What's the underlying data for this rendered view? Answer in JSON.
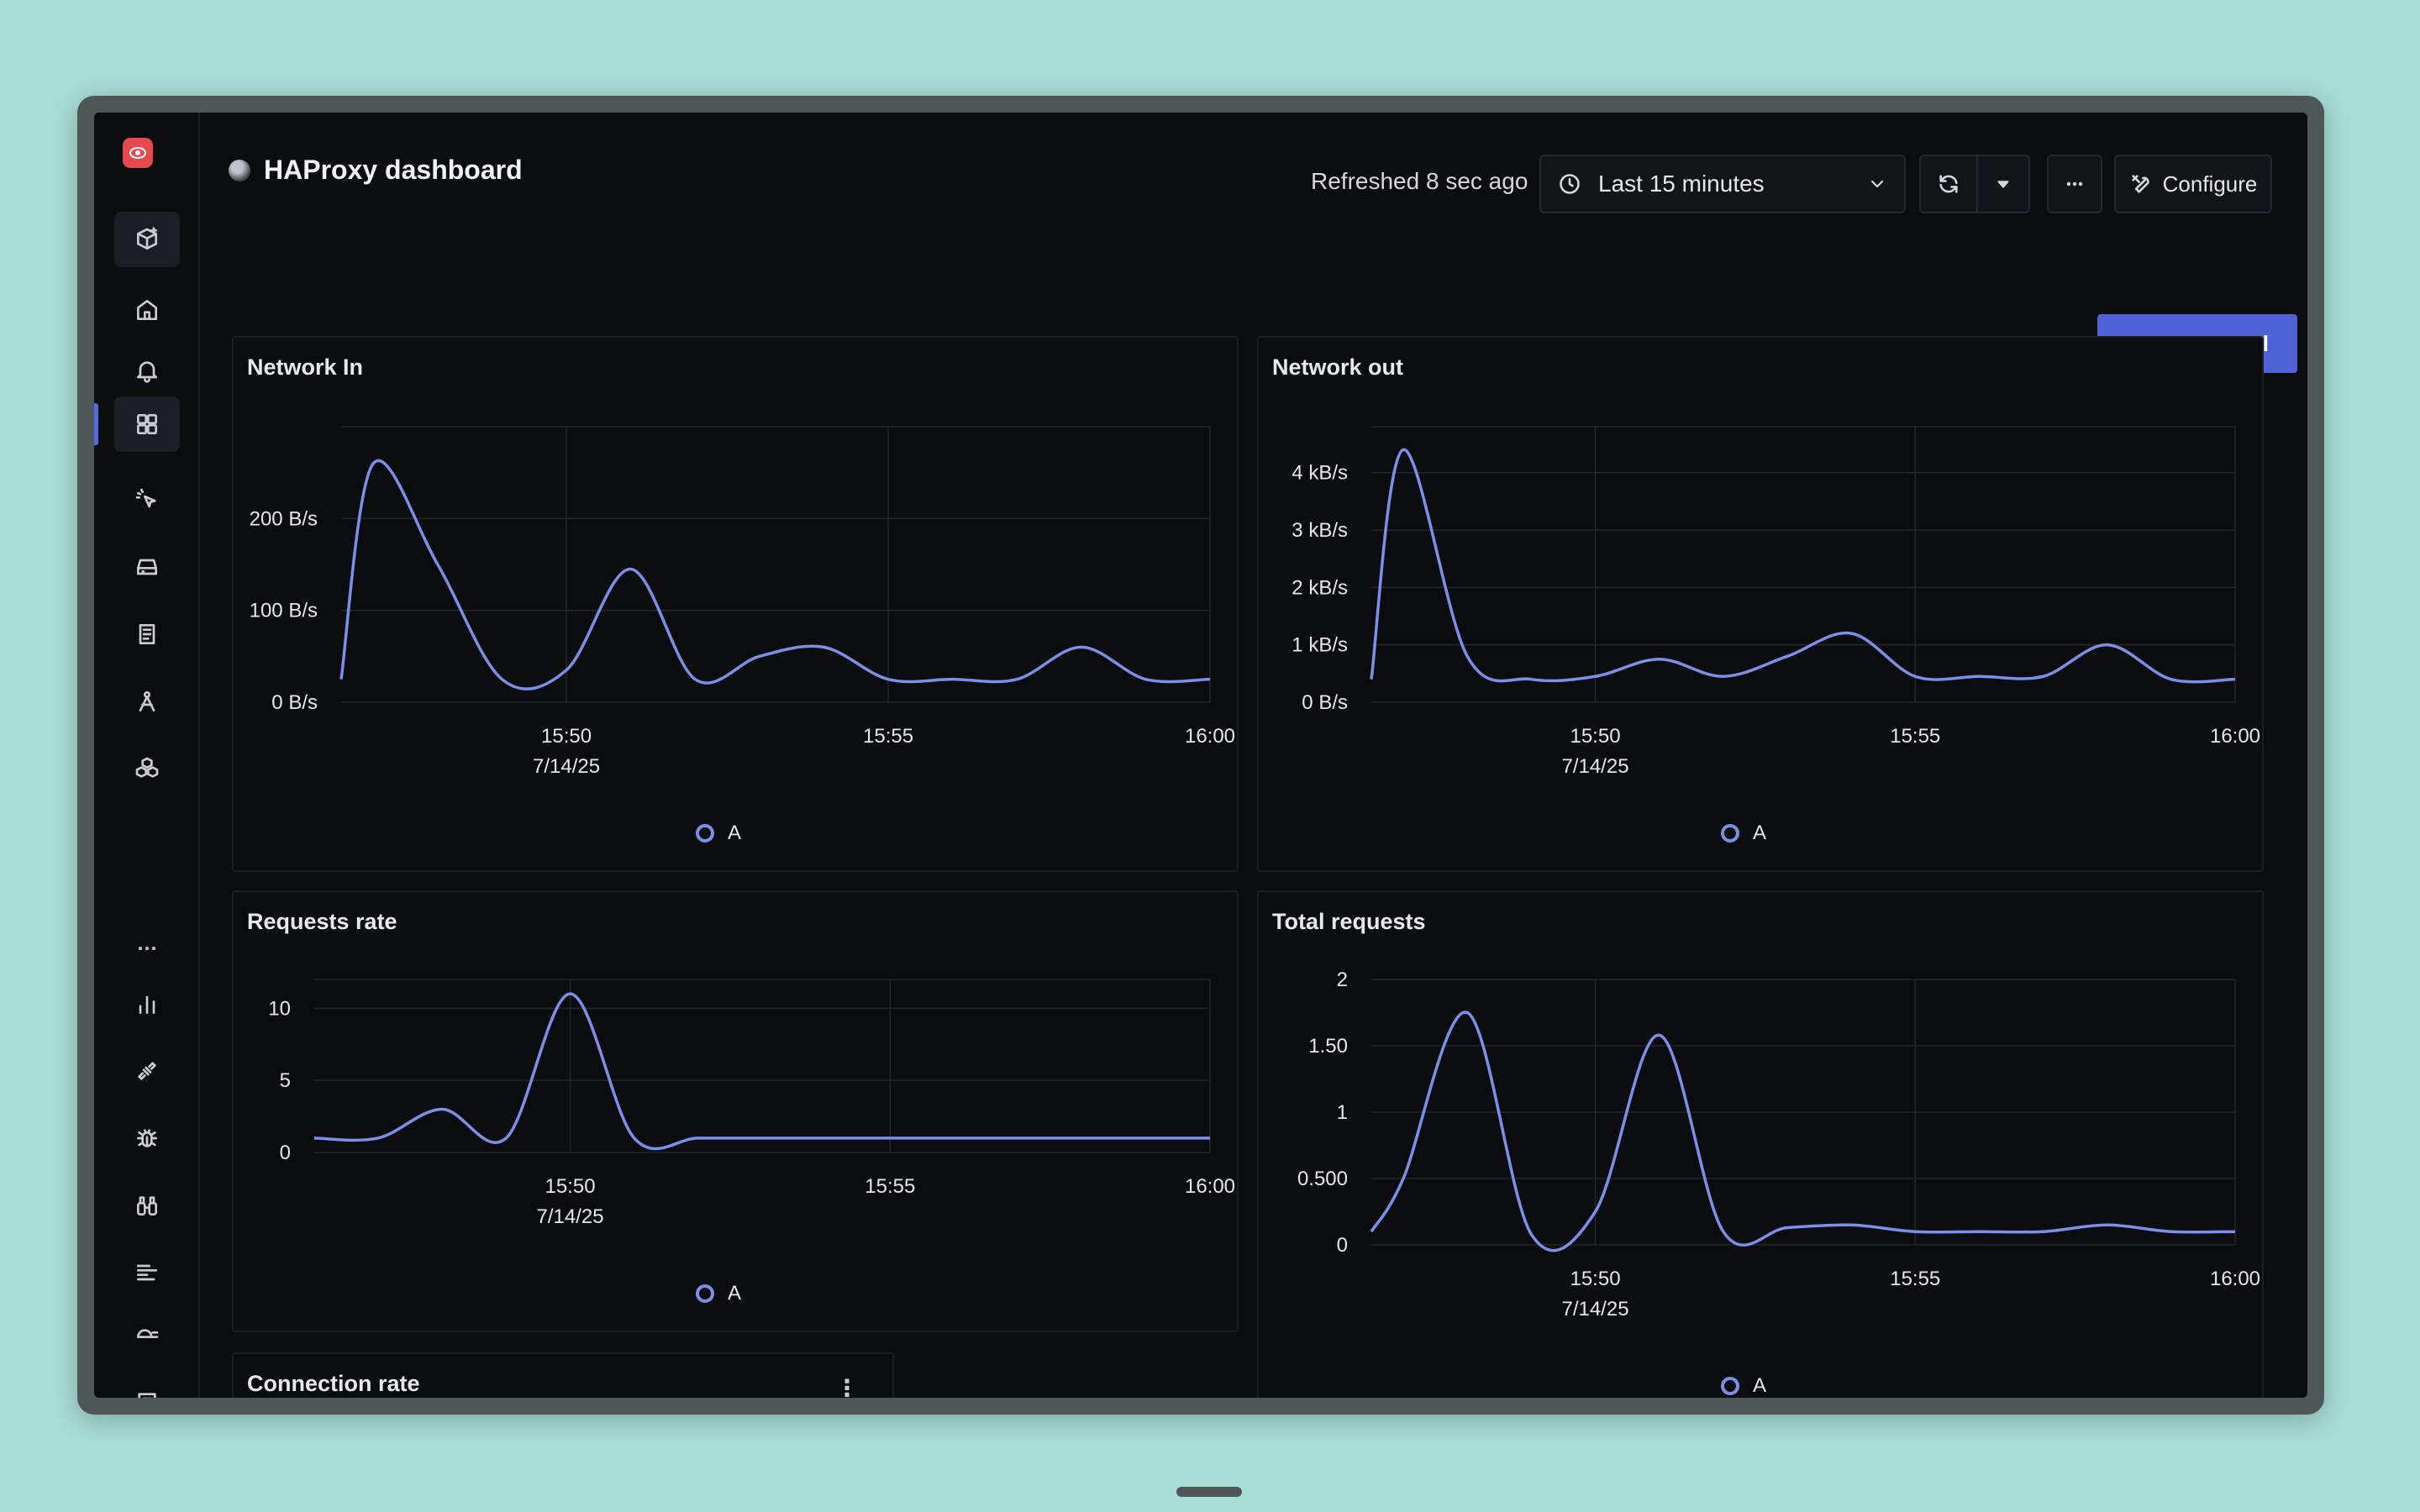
{
  "dashboard": {
    "title": "HAProxy dashboard",
    "refreshed": "Refreshed 8 sec ago",
    "time_range": "Last 15 minutes",
    "configure_label": "Configure",
    "new_panel_label": "New Panel"
  },
  "sidebar": {
    "items": [
      {
        "name": "new-dashboard-icon"
      },
      {
        "name": "home-icon"
      },
      {
        "name": "alerts-icon"
      },
      {
        "name": "dashboards-icon",
        "active": true
      },
      {
        "name": "explore-icon"
      },
      {
        "name": "infrastructure-icon"
      },
      {
        "name": "logs-icon"
      },
      {
        "name": "traces-icon"
      },
      {
        "name": "services-icon"
      },
      {
        "name": "more-icon"
      },
      {
        "name": "metrics-icon"
      },
      {
        "name": "integrations-icon"
      },
      {
        "name": "exceptions-icon"
      },
      {
        "name": "explorer-icon"
      },
      {
        "name": "pipelines-icon"
      },
      {
        "name": "billing-icon"
      },
      {
        "name": "feedback-icon"
      },
      {
        "name": "settings-icon"
      }
    ]
  },
  "colors": {
    "series": "#7b8fe8",
    "accent": "#4e62d6",
    "logo": "#e5484d"
  },
  "panels": [
    {
      "title": "Network In",
      "legend": "A",
      "chart_data": {
        "type": "line",
        "title": "Network In",
        "x_ticks": [
          "15:50",
          "15:55",
          "16:00"
        ],
        "x_date": "7/14/25",
        "y_ticks": [
          "0 B/s",
          "100 B/s",
          "200 B/s"
        ],
        "ylim": [
          0,
          300
        ],
        "x": [
          "15:46:30",
          "15:47",
          "15:48",
          "15:49",
          "15:50",
          "15:51",
          "15:52",
          "15:53",
          "15:54",
          "15:55",
          "15:56",
          "15:57",
          "15:58",
          "15:59",
          "16:00"
        ],
        "series": [
          {
            "name": "A",
            "values": [
              25,
              260,
              150,
              25,
              35,
              145,
              25,
              50,
              60,
              25,
              25,
              25,
              60,
              25,
              25
            ]
          }
        ]
      }
    },
    {
      "title": "Network out",
      "legend": "A",
      "chart_data": {
        "type": "line",
        "title": "Network out",
        "x_ticks": [
          "15:50",
          "15:55",
          "16:00"
        ],
        "x_date": "7/14/25",
        "y_ticks": [
          "0 B/s",
          "1 kB/s",
          "2 kB/s",
          "3 kB/s",
          "4 kB/s"
        ],
        "ylim": [
          0,
          4800
        ],
        "x": [
          "15:46:30",
          "15:47",
          "15:48",
          "15:49",
          "15:50",
          "15:51",
          "15:52",
          "15:53",
          "15:54",
          "15:55",
          "15:56",
          "15:57",
          "15:58",
          "15:59",
          "16:00"
        ],
        "series": [
          {
            "name": "A",
            "values": [
              400,
              4400,
              800,
              400,
              450,
              750,
              450,
              800,
              1200,
              450,
              450,
              450,
              1000,
              400,
              400
            ]
          }
        ]
      }
    },
    {
      "title": "Requests rate",
      "legend": "A",
      "chart_data": {
        "type": "line",
        "title": "Requests rate",
        "x_ticks": [
          "15:50",
          "15:55",
          "16:00"
        ],
        "x_date": "7/14/25",
        "y_ticks": [
          "0",
          "5",
          "10"
        ],
        "ylim": [
          0,
          12
        ],
        "x": [
          "15:46",
          "15:47",
          "15:48",
          "15:49",
          "15:50",
          "15:51",
          "15:52",
          "15:53",
          "15:54",
          "15:55",
          "15:56",
          "15:57",
          "15:58",
          "15:59",
          "16:00"
        ],
        "series": [
          {
            "name": "A",
            "values": [
              1,
              1,
              3,
              1,
              11,
              1,
              1,
              1,
              1,
              1,
              1,
              1,
              1,
              1,
              1
            ]
          }
        ]
      }
    },
    {
      "title": "Total requests",
      "legend": "A",
      "chart_data": {
        "type": "line",
        "title": "Total requests",
        "x_ticks": [
          "15:50",
          "15:55",
          "16:00"
        ],
        "x_date": "7/14/25",
        "y_ticks": [
          "0",
          "0.500",
          "1",
          "1.50",
          "2"
        ],
        "ylim": [
          0,
          2
        ],
        "x": [
          "15:46:30",
          "15:47",
          "15:48",
          "15:49",
          "15:50",
          "15:51",
          "15:52",
          "15:53",
          "15:54",
          "15:55",
          "15:56",
          "15:57",
          "15:58",
          "15:59",
          "16:00"
        ],
        "series": [
          {
            "name": "A",
            "values": [
              0.1,
              0.5,
              1.75,
              0.08,
              0.25,
              1.58,
              0.1,
              0.13,
              0.15,
              0.1,
              0.1,
              0.1,
              0.15,
              0.1,
              0.1
            ]
          }
        ]
      }
    },
    {
      "title": "Connection rate"
    }
  ]
}
